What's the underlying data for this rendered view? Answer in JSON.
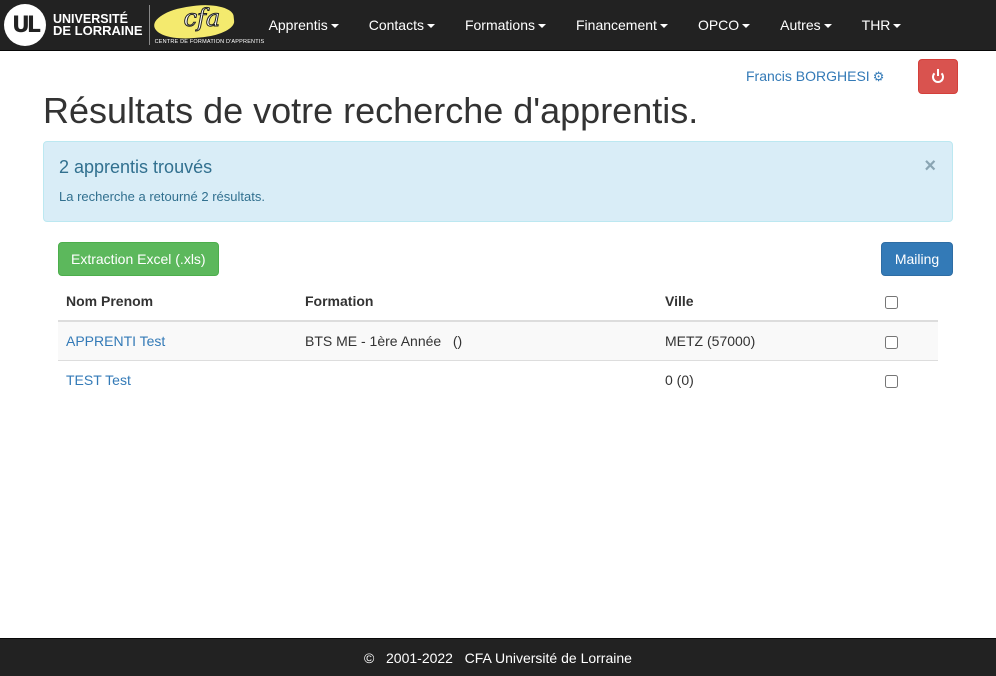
{
  "brand": {
    "university_line1": "UNIVERSITÉ",
    "university_line2": "DE LORRAINE",
    "cfa_word": "cfa",
    "cfa_tagline": "CENTRE DE FORMATION D'APPRENTIS"
  },
  "nav": {
    "items": [
      {
        "label": "Apprentis"
      },
      {
        "label": "Contacts"
      },
      {
        "label": "Formations"
      },
      {
        "label": "Financement"
      },
      {
        "label": "OPCO"
      },
      {
        "label": "Autres"
      },
      {
        "label": "THR"
      }
    ]
  },
  "user": {
    "name": "Francis BORGHESI",
    "settings_icon": "gear-icon",
    "logout_icon": "power-icon"
  },
  "page": {
    "title": "Résultats de votre recherche d'apprentis."
  },
  "alert": {
    "title": "2 apprentis trouvés",
    "text": "La recherche a retourné 2 résultats.",
    "close": "×"
  },
  "actions": {
    "excel_label": "Extraction Excel (.xls)",
    "mailing_label": "Mailing"
  },
  "table": {
    "headers": {
      "name": "Nom Prenom",
      "formation": "Formation",
      "ville": "Ville"
    },
    "rows": [
      {
        "name": "APPRENTI Test",
        "formation": "BTS ME - 1ère Année   ()",
        "ville": "METZ (57000)"
      },
      {
        "name": "TEST Test",
        "formation": "",
        "ville": "0 (0)"
      }
    ]
  },
  "footer": {
    "text": "©   2001-2022   CFA Université de Lorraine"
  },
  "colors": {
    "navbar": "#222222",
    "link": "#337ab7",
    "alert_bg": "#d9edf7",
    "success": "#5cb85c",
    "danger": "#d9534f",
    "primary": "#337ab7"
  }
}
